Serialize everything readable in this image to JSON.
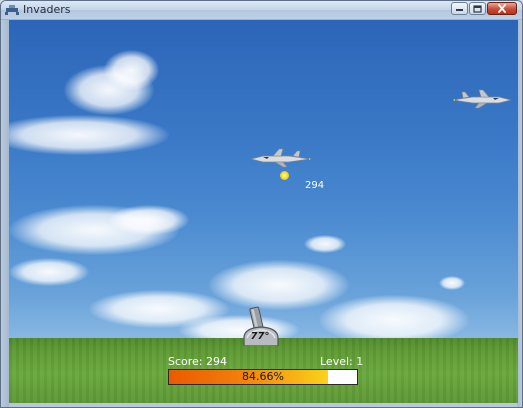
{
  "window": {
    "title": "Invaders"
  },
  "game": {
    "floating_points": "294",
    "cannon_angle": "77°",
    "progress_percent": 84.66
  },
  "hud": {
    "score_label": "Score:",
    "score_value": "294",
    "level_label": "Level:",
    "level_value": "1",
    "progress_text": "84.66%"
  },
  "icons": {
    "app": "invaders-app-icon",
    "minimize": "minimize-icon",
    "maximize": "maximize-icon",
    "close": "close-icon"
  },
  "colors": {
    "sky_top": "#2c65b8",
    "sky_bottom": "#8dbbe4",
    "grass": "#5e9a34",
    "progress_start": "#ea5a00",
    "progress_end": "#fbd21c"
  }
}
